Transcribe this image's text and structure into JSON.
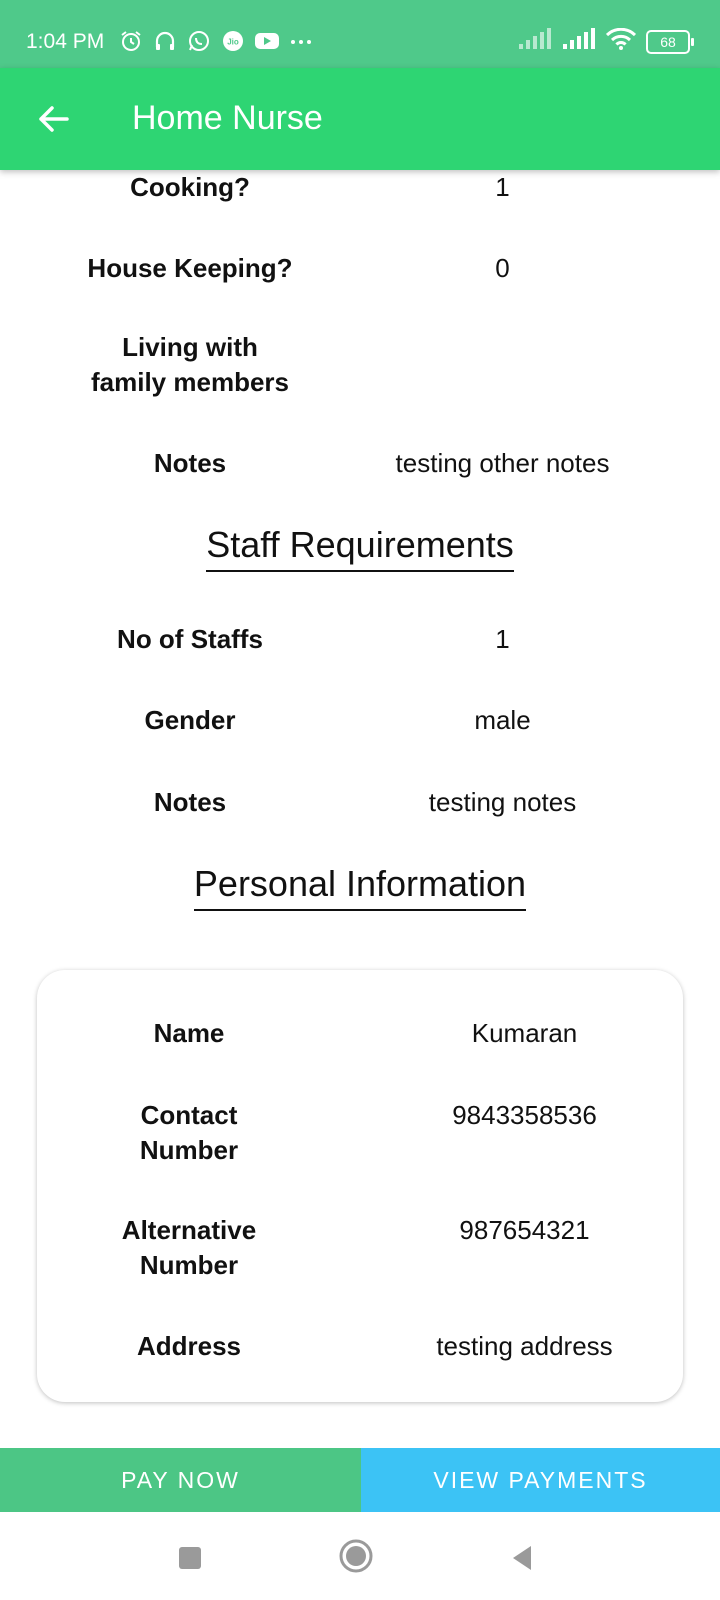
{
  "status_bar": {
    "time": "1:04 PM",
    "battery": "68",
    "icons_left": [
      "alarm-icon",
      "headphones-icon",
      "whatsapp-icon",
      "jio-icon",
      "youtube-icon",
      "more-icon"
    ],
    "icons_right": [
      "signal-icon",
      "signal-icon",
      "wifi-icon",
      "battery-icon"
    ]
  },
  "app_bar": {
    "title": "Home Nurse",
    "back_icon": "arrow-left-icon",
    "color": "#2ed573"
  },
  "details": [
    {
      "label": "Cooking?",
      "value": "1"
    },
    {
      "label": "House Keeping?",
      "value": "0"
    },
    {
      "label_lines": [
        "Living with",
        "family members"
      ],
      "value": ""
    },
    {
      "label": "Notes",
      "value": "testing other notes"
    }
  ],
  "staff_requirements": {
    "title": "Staff Requirements",
    "rows": [
      {
        "label": "No of Staffs",
        "value": "1"
      },
      {
        "label": "Gender",
        "value": "male"
      },
      {
        "label": "Notes",
        "value": "testing notes"
      }
    ]
  },
  "personal_information": {
    "title": "Personal Information",
    "rows": [
      {
        "label": "Name",
        "value": "Kumaran"
      },
      {
        "label_lines": [
          "Contact",
          "Number"
        ],
        "value": "9843358536"
      },
      {
        "label_lines": [
          "Alternative",
          "Number"
        ],
        "value": "987654321"
      },
      {
        "label": "Address",
        "value": "testing address"
      }
    ]
  },
  "buttons": {
    "pay_now": "PAY NOW",
    "view_payments": "VIEW PAYMENTS",
    "pay_color": "#4cc685",
    "view_color": "#3cc3f5"
  },
  "nav_bar": {
    "icons": [
      "recent-apps-icon",
      "home-icon",
      "back-icon"
    ]
  }
}
